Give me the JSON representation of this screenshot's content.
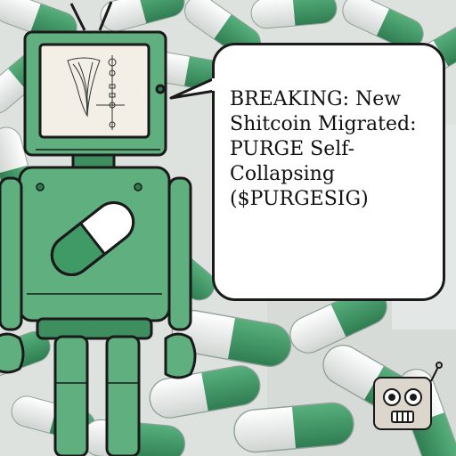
{
  "headline": {
    "lines": [
      "BREAKING: New",
      "Shitcoin Migrated:",
      "PURGE Self-",
      "Collapsing",
      "($PURGESIG)"
    ]
  },
  "palette": {
    "pill_green": "#3f9a66",
    "robot_green": "#5fb07e",
    "robot_dark": "#2e7a50",
    "outline": "#1a1a1a",
    "bubble_fill": "#ffffff"
  },
  "icons": {
    "screen": "funnel-diagram-icon",
    "chest": "pill-icon",
    "corner": "robot-head-logo"
  }
}
